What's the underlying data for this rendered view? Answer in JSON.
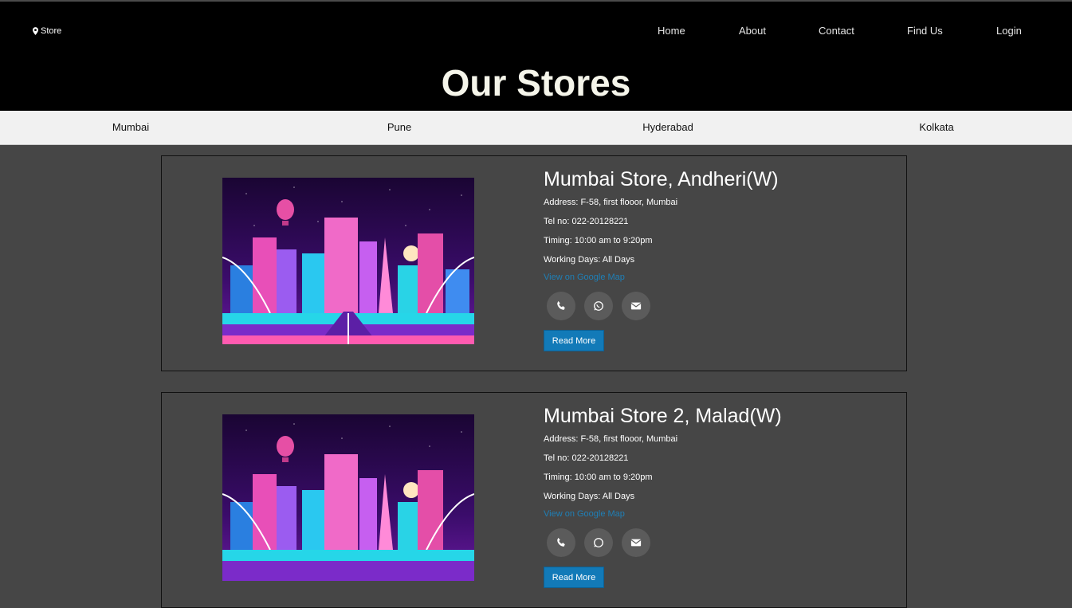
{
  "brand": {
    "label": "Store",
    "icon": "map-marker-icon"
  },
  "nav": [
    "Home",
    "About",
    "Contact",
    "Find Us",
    "Login"
  ],
  "page_title": "Our Stores",
  "cities": [
    "Mumbai",
    "Pune",
    "Hyderabad",
    "Kolkata"
  ],
  "stores": [
    {
      "name": "Mumbai Store, Andheri(W)",
      "address": "Address: F-58, first flooor, Mumbai",
      "tel": "Tel no: 022-20128221",
      "timing": "Timing: 10:00 am to 9:20pm",
      "days": "Working Days: All Days",
      "map_link": "View on Google Map",
      "read_more": "Read More"
    },
    {
      "name": "Mumbai Store 2, Malad(W)",
      "address": "Address: F-58, first flooor, Mumbai",
      "tel": "Tel no: 022-20128221",
      "timing": "Timing: 10:00 am to 9:20pm",
      "days": "Working Days: All Days",
      "map_link": "View on Google Map",
      "read_more": "Read More"
    }
  ],
  "contact_icons": [
    "phone-icon",
    "whatsapp-icon",
    "envelope-icon"
  ],
  "colors": {
    "header_bg": "#000000",
    "page_bg": "#464646",
    "link": "#1f7fb6",
    "button": "#127ab8",
    "city_bar": "#f1f1f1"
  }
}
